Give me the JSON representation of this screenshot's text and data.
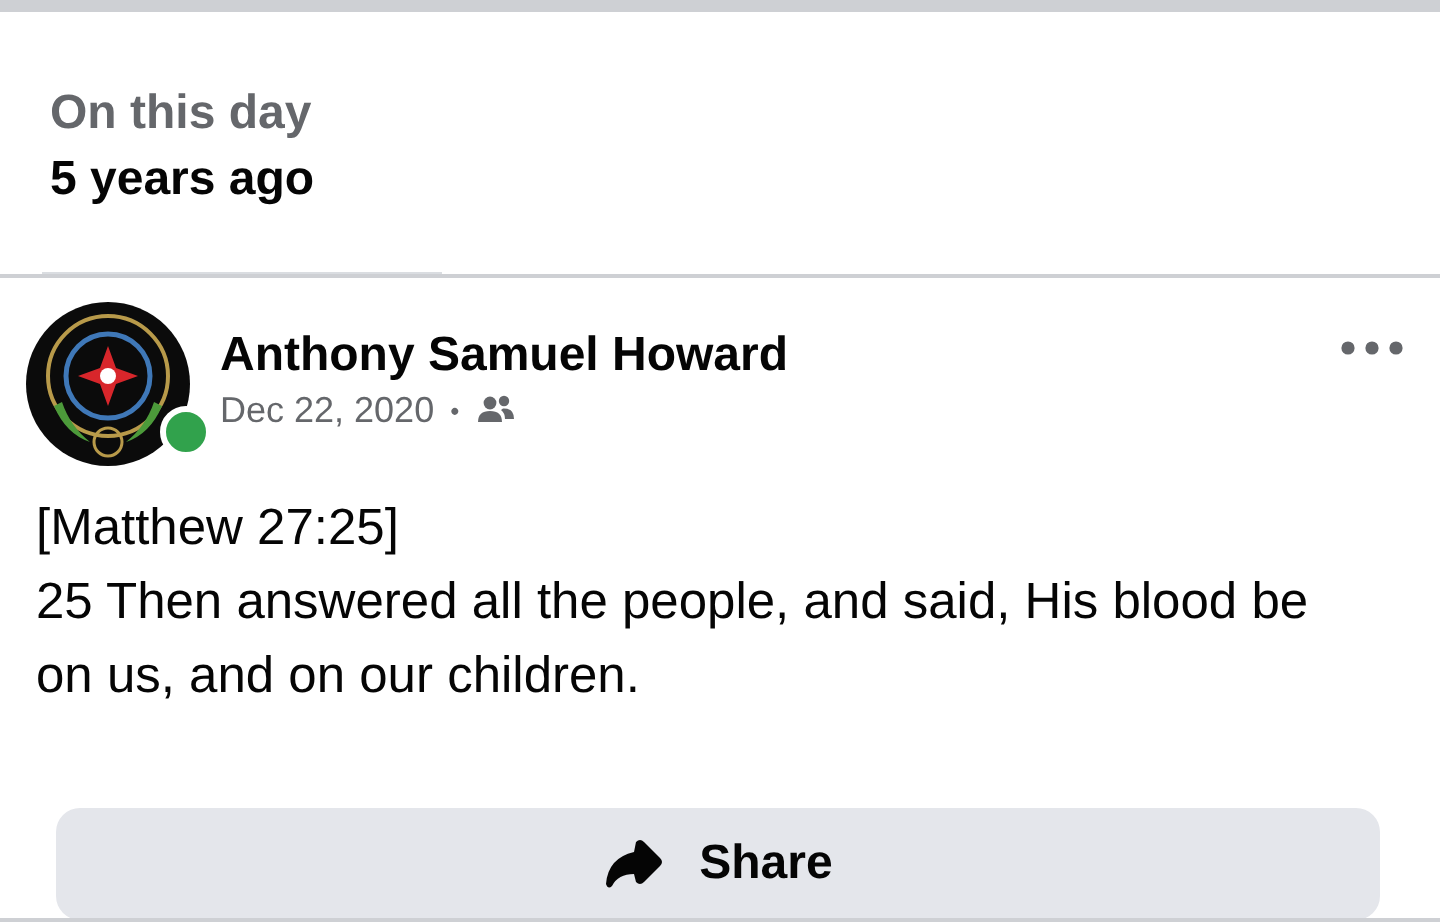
{
  "memory": {
    "title": "On this day",
    "subtitle": "5 years ago"
  },
  "post": {
    "author": "Anthony Samuel Howard",
    "online": true,
    "date": "Dec 22, 2020",
    "separator": "•",
    "body": [
      "[Matthew 27:25]",
      "25 Then answered all the people, and said, His blood be on us, and on our children."
    ]
  },
  "actions": [
    {
      "kind": "share",
      "label": "Share"
    }
  ]
}
